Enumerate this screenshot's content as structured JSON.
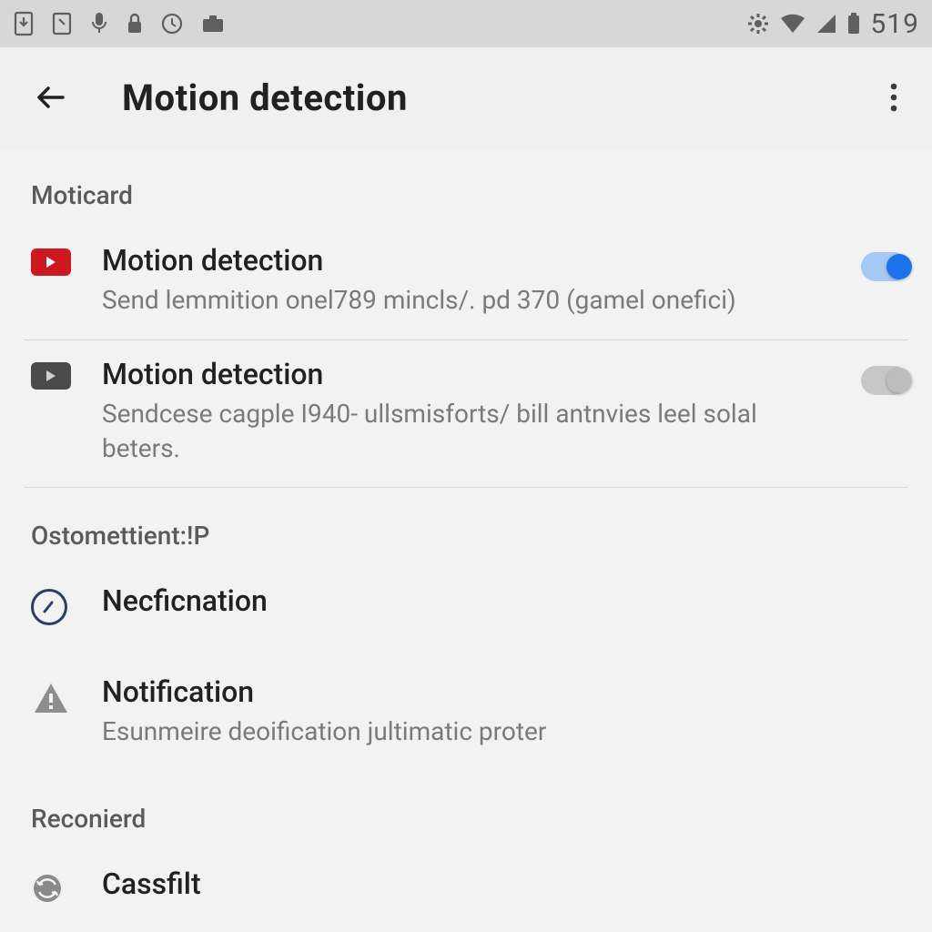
{
  "status_bar": {
    "time": "519"
  },
  "app_bar": {
    "title": "Motion detection"
  },
  "sections": {
    "moticard": {
      "header": "Moticard",
      "items": [
        {
          "title": "Motion detection",
          "subtitle": "Send lemmition onel789 mincls/. pd 370 (gamel onefici)",
          "toggle": true
        },
        {
          "title": "Motion detection",
          "subtitle": "Sendcese cagple I940- ullsmisforts/ bill antnvies leel solal beters.",
          "toggle": false
        }
      ]
    },
    "ostomettient": {
      "header": "Ostomettient:!P",
      "items": [
        {
          "title": "Necficnation"
        },
        {
          "title": "Notification",
          "subtitle": "Esunmeire deoification jultimatic proter"
        }
      ]
    },
    "reconierd": {
      "header": "Reconierd",
      "items": [
        {
          "title": "Cassfilt"
        }
      ]
    }
  }
}
